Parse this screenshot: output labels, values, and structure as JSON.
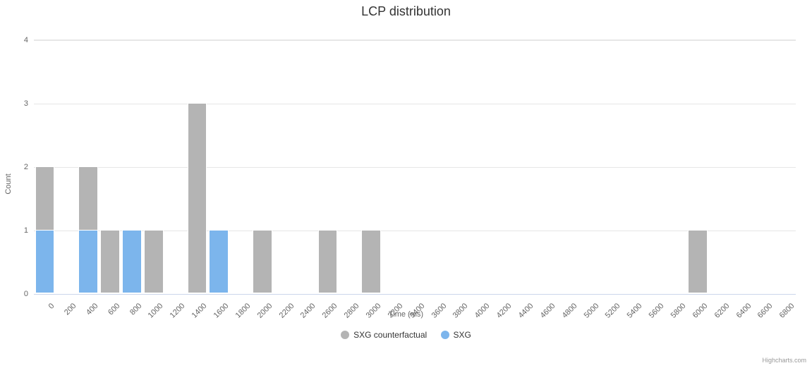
{
  "chart_data": {
    "type": "bar",
    "title": "LCP distribution",
    "xlabel": "Time (ms)",
    "ylabel": "Count",
    "ylim": [
      0,
      4
    ],
    "categories": [
      "0",
      "200",
      "400",
      "600",
      "800",
      "1000",
      "1200",
      "1400",
      "1600",
      "1800",
      "2000",
      "2200",
      "2400",
      "2600",
      "2800",
      "3000",
      "3200",
      "3400",
      "3600",
      "3800",
      "4000",
      "4200",
      "4400",
      "4600",
      "4800",
      "5000",
      "5200",
      "5400",
      "5600",
      "5800",
      "6000",
      "6200",
      "6400",
      "6600",
      "6800"
    ],
    "series": [
      {
        "name": "SXG counterfactual",
        "color": "#b4b4b4",
        "values": [
          2,
          0,
          2,
          1,
          1,
          1,
          0,
          3,
          0,
          0,
          1,
          0,
          0,
          1,
          0,
          1,
          0,
          0,
          0,
          0,
          0,
          0,
          0,
          0,
          0,
          0,
          0,
          0,
          0,
          0,
          1,
          0,
          0,
          0,
          0
        ]
      },
      {
        "name": "SXG",
        "color": "#7cb5ec",
        "values": [
          1,
          0,
          1,
          0,
          1,
          0,
          0,
          0,
          1,
          0,
          0,
          0,
          0,
          0,
          0,
          0,
          0,
          0,
          0,
          0,
          0,
          0,
          0,
          0,
          0,
          0,
          0,
          0,
          0,
          0,
          0,
          0,
          0,
          0,
          0
        ]
      }
    ],
    "credits": "Highcharts.com"
  }
}
